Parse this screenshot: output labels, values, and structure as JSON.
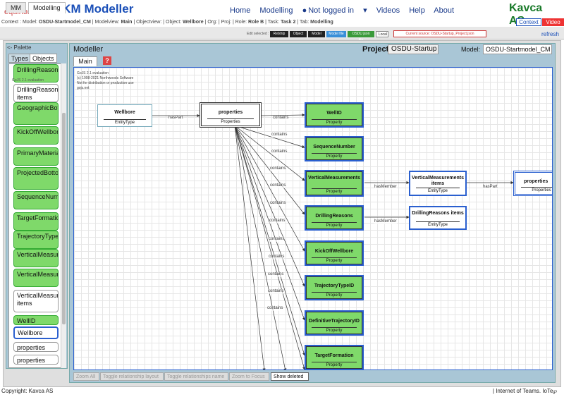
{
  "header": {
    "equinor_logo": "equinor",
    "app_title": "AKM Modeller",
    "nav": [
      "Home",
      "Modelling",
      "Not logged in",
      "Videos",
      "Help",
      "About"
    ],
    "brand": "Kavca AS"
  },
  "context_line": {
    "prefix": "Context : Model: ",
    "model": "OSDU-Startmodel_CM",
    "mv_prefix": " | Modelview: ",
    "modelview": "Main",
    "ov_prefix": " | Objectview: | Object: ",
    "object": "Wellbore",
    "rest": " | Org: | Proj: | Role: ",
    "role": "Role B",
    "task_prefix": " | Task: ",
    "task": "Task 2",
    "tab_prefix": " | Tab: ",
    "tab": "Modelling",
    "context_btn": "Context",
    "video_btn": "Video"
  },
  "tabs": [
    "MM",
    "Modelling"
  ],
  "edit_bar": {
    "label": "Edit selected :",
    "buttons": [
      "Relship",
      "Object",
      "Model",
      "Model file",
      "OSDU json file",
      "Local"
    ],
    "current_source": "Current source: OSDU-Startup_Project.json",
    "refresh": "refresh"
  },
  "palette": {
    "title": "<- Palette",
    "tabs": [
      "Types",
      "Objects"
    ],
    "overlay_text": "GoJS 2.1 evaluation",
    "items": [
      {
        "label": "DrillingReasons",
        "style": "g"
      },
      {
        "label": "DrillingReasons items",
        "style": "w"
      },
      {
        "label": "GeographicBottomHoleLocation",
        "style": "g"
      },
      {
        "label": "KickOffWellbore",
        "style": "g"
      },
      {
        "label": "PrimaryMaterialID",
        "style": "g"
      },
      {
        "label": "ProjectedBottomHoleLocation",
        "style": "g"
      },
      {
        "label": "SequenceNumber",
        "style": "g"
      },
      {
        "label": "TargetFormation",
        "style": "g"
      },
      {
        "label": "TrajectoryTypeID",
        "style": "g"
      },
      {
        "label": "VerticalMeasurementID",
        "style": "g"
      },
      {
        "label": "VerticalMeasurements",
        "style": "g"
      },
      {
        "label": "VerticalMeasurements items",
        "style": "w"
      },
      {
        "label": "WellID",
        "style": "g"
      },
      {
        "label": "Wellbore",
        "style": "sel"
      },
      {
        "label": "properties",
        "style": "w"
      },
      {
        "label": "properties",
        "style": "w"
      }
    ]
  },
  "modeler": {
    "title": "Modeller",
    "project_label": "Project:",
    "project_name": "OSDU-Startup",
    "model_label": "Model:",
    "model_value": "OSDU-Startmodel_CM",
    "tab_main": "Main",
    "help": "?"
  },
  "canvas": {
    "gojs_notice": [
      "GoJS 2.1 evaluation",
      "(c) 1998-2021 Northwoods Software",
      "Not for distribution or production use",
      "gojs.net"
    ],
    "nodes": {
      "wellbore": {
        "name": "Wellbore",
        "type": "EntityType"
      },
      "properties": {
        "name": "properties",
        "type": "Properties"
      },
      "wellid": {
        "name": "WellID",
        "type": "Property"
      },
      "seqnum": {
        "name": "SequenceNumber",
        "type": "Property"
      },
      "vertmeas": {
        "name": "VerticalMeasurements",
        "type": "Property"
      },
      "drillreasons": {
        "name": "DrillingReasons",
        "type": "Property"
      },
      "kickoff": {
        "name": "KickOffWellbore",
        "type": "Property"
      },
      "trajtype": {
        "name": "TrajectoryTypeID",
        "type": "Property"
      },
      "deftraj": {
        "name": "DefinitiveTrajectoryID",
        "type": "Property"
      },
      "targetform": {
        "name": "TargetFormation",
        "type": "Property"
      },
      "vmitems": {
        "name": "VerticalMeasurements items",
        "type": "EntityType"
      },
      "dritems": {
        "name": "DrillingReasons items",
        "type": "EntityType"
      },
      "props2": {
        "name": "properties",
        "type": "Properties"
      }
    },
    "edges": {
      "has_part": "hasPart",
      "contains": "contains",
      "has_member": "hasMember"
    }
  },
  "bottom_buttons": [
    "Zoom All",
    "Toggle relationship layout",
    "Toggle relationships name",
    "Zoom to Focus",
    "Show deleted"
  ],
  "footer": {
    "left": "Copyright: Kavca AS",
    "right": "| Internet of Teams. IoTe℘"
  }
}
